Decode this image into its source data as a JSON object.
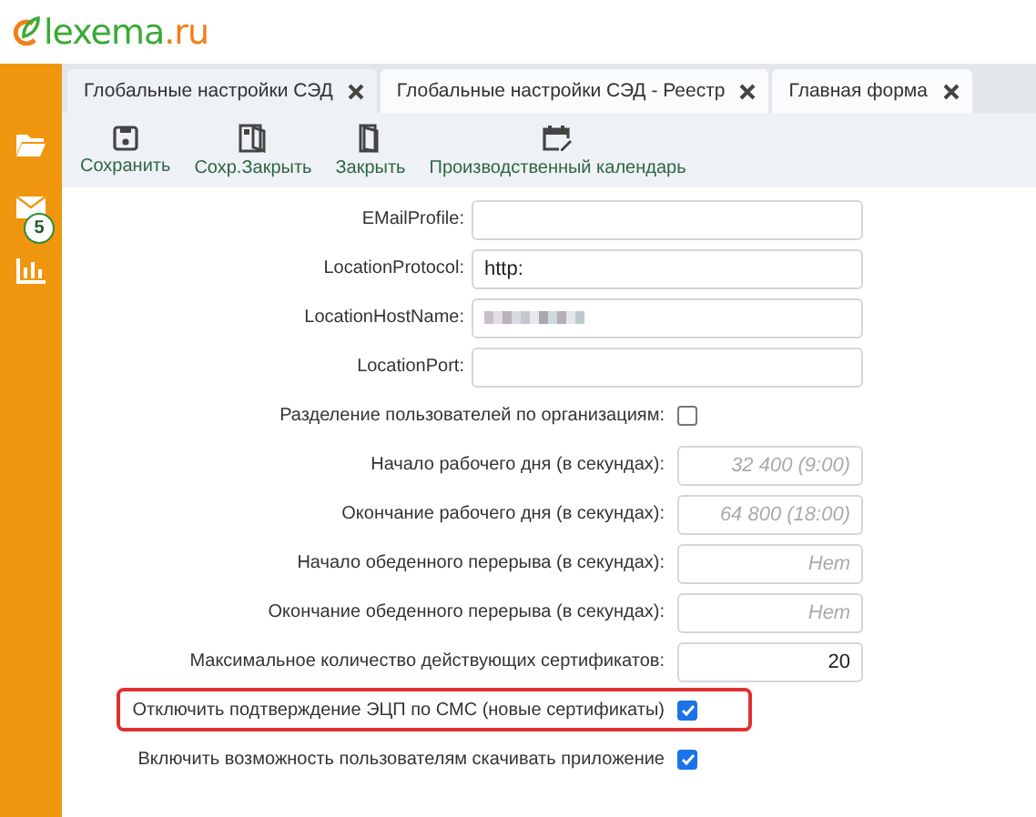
{
  "logo": {
    "name": "lexema",
    "domain": ".ru"
  },
  "sidebar": {
    "items": [
      {
        "kind": "folder"
      },
      {
        "kind": "mail",
        "badge": "5"
      },
      {
        "kind": "chart"
      }
    ]
  },
  "tabs": [
    {
      "label": "Глобальные настройки СЭД",
      "selected": true
    },
    {
      "label": "Глобальные настройки СЭД - Реестр",
      "selected": false
    },
    {
      "label": "Главная форма",
      "selected": false
    }
  ],
  "toolbar": [
    {
      "kind": "save",
      "label": "Сохранить"
    },
    {
      "kind": "save-close",
      "label": "Сохр.Закрыть"
    },
    {
      "kind": "close",
      "label": "Закрыть"
    },
    {
      "kind": "calendar",
      "label": "Производственный календарь"
    }
  ],
  "form": [
    {
      "kind": "text",
      "label": "EMailProfile:"
    },
    {
      "kind": "text",
      "label": "LocationProtocol:",
      "value": "http:"
    },
    {
      "kind": "blurred",
      "label": "LocationHostName:"
    },
    {
      "kind": "text",
      "label": "LocationPort:"
    },
    {
      "kind": "checkbox",
      "label": "Разделение пользователей по организациям:",
      "checked": false,
      "highlighted": false
    },
    {
      "kind": "number",
      "label": "Начало рабочего дня (в секундах):",
      "placeholder": "32 400 (9:00)"
    },
    {
      "kind": "number",
      "label": "Окончание рабочего дня (в секундах):",
      "placeholder": "64 800 (18:00)"
    },
    {
      "kind": "number",
      "label": "Начало обеденного перерыва (в секундах):",
      "placeholder": "Нет"
    },
    {
      "kind": "number",
      "label": "Окончание обеденного перерыва (в секундах):",
      "placeholder": "Нет"
    },
    {
      "kind": "number",
      "label": "Максимальное количество действующих сертификатов:",
      "value": "20"
    },
    {
      "kind": "checkbox",
      "label": "Отключить подтверждение ЭЦП по СМС (новые сертификаты)",
      "checked": true,
      "highlighted": true
    },
    {
      "kind": "checkbox",
      "label": "Включить возможность пользователям скачивать приложение",
      "checked": true,
      "highlighted": false
    }
  ]
}
